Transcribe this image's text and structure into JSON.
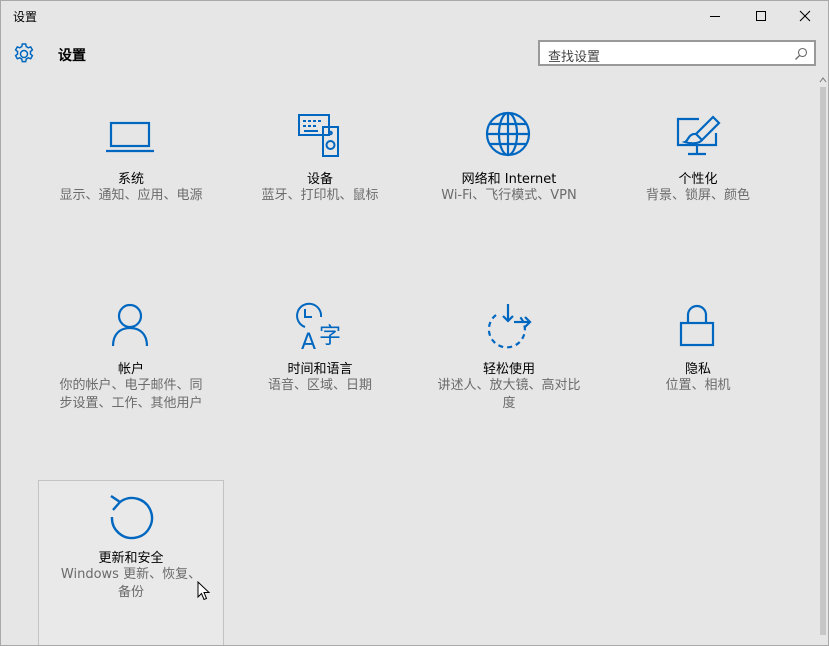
{
  "window": {
    "title": "设置",
    "controls": [
      "minimize",
      "maximize",
      "close"
    ]
  },
  "header": {
    "title": "设置",
    "icon": "gear-icon"
  },
  "search": {
    "placeholder": "查找设置",
    "icon": "search-icon"
  },
  "accent_color": "#0067c0",
  "tiles": [
    {
      "title": "系统",
      "desc": "显示、通知、应用、电源",
      "icon": "laptop-icon"
    },
    {
      "title": "设备",
      "desc": "蓝牙、打印机、鼠标",
      "icon": "devices-icon"
    },
    {
      "title": "网络和 Internet",
      "desc": "Wi-Fi、飞行模式、VPN",
      "icon": "globe-icon"
    },
    {
      "title": "个性化",
      "desc": "背景、锁屏、颜色",
      "icon": "paint-icon"
    },
    {
      "title": "帐户",
      "desc": "你的帐户、电子邮件、同步设置、工作、其他用户",
      "icon": "person-icon"
    },
    {
      "title": "时间和语言",
      "desc": "语音、区域、日期",
      "icon": "time-language-icon"
    },
    {
      "title": "轻松使用",
      "desc": "讲述人、放大镜、高对比度",
      "icon": "ease-of-access-icon"
    },
    {
      "title": "隐私",
      "desc": "位置、相机",
      "icon": "lock-icon"
    },
    {
      "title": "更新和安全",
      "desc": "Windows 更新、恢复、备份",
      "icon": "update-icon"
    }
  ]
}
